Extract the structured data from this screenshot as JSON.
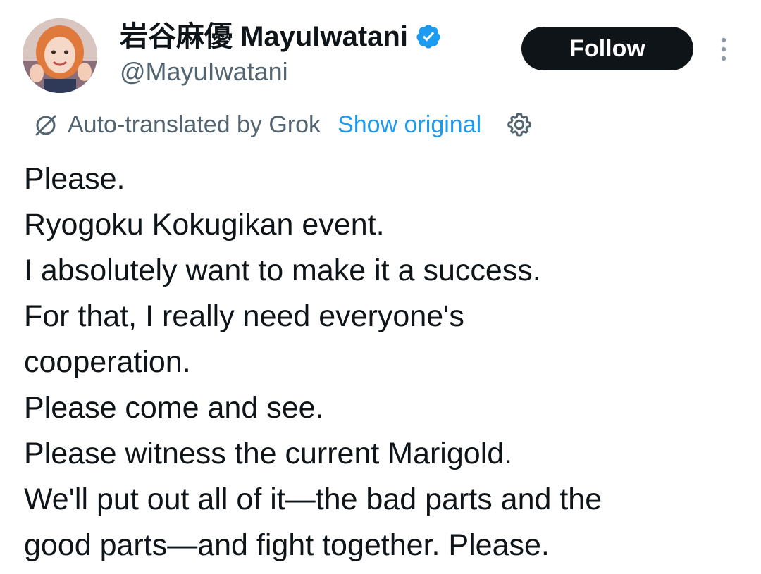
{
  "author": {
    "display_name": "岩谷麻優 MayuIwatani",
    "handle": "@MayuIwatani",
    "verified": true,
    "avatar_icon": "profile-photo"
  },
  "actions": {
    "follow_label": "Follow",
    "more_icon": "vertical-ellipsis-icon"
  },
  "translation": {
    "label": "Auto-translated by Grok",
    "show_original_label": "Show original",
    "icon": "translate-slash-icon",
    "settings_icon": "gear-icon"
  },
  "tweet": {
    "lines": [
      "Please.",
      "Ryogoku Kokugikan event.",
      "I absolutely want to make it a success.",
      "For that, I really need everyone's",
      "cooperation.",
      "Please come and see.",
      "Please witness the current Marigold.",
      "We'll put out all of it—the bad parts and the",
      "good parts—and fight together. Please."
    ]
  },
  "colors": {
    "text": "#0f1419",
    "secondary": "#536471",
    "link": "#1d9bf0",
    "verified": "#1d9bf0",
    "button_bg": "#0f1419",
    "button_text": "#ffffff"
  }
}
